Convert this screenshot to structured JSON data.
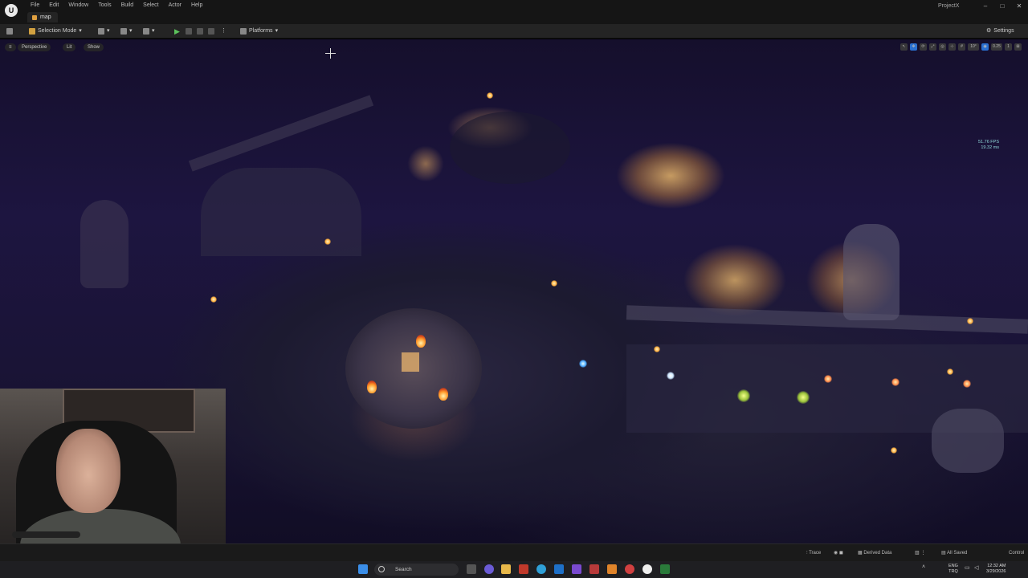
{
  "window": {
    "menu": [
      "File",
      "Edit",
      "Window",
      "Tools",
      "Build",
      "Select",
      "Actor",
      "Help"
    ],
    "tab_label": "map",
    "project_name": "ProjectX",
    "controls": [
      "–",
      "□",
      "✕"
    ]
  },
  "toolbar": {
    "selection_mode": "Selection Mode",
    "platforms": "Platforms",
    "settings": "Settings"
  },
  "viewport": {
    "perspective": "Perspective",
    "lit": "Lit",
    "show": "Show",
    "grid_snap": "10°",
    "camera_speed": "0.25",
    "screen_pct": "1",
    "fps": "51.76 FPS",
    "frame_ms": "19.32 ms"
  },
  "statusbar": {
    "trace": "Trace",
    "derived_data": "Derived Data",
    "all_saved": "All Saved",
    "source_control": "Control"
  },
  "taskbar": {
    "search_placeholder": "Search",
    "lang_primary": "ENG",
    "lang_secondary": "TRQ",
    "time": "12:32 AM",
    "date": "3/29/2026"
  },
  "colors": {
    "accent": "#2a6fd0",
    "play_green": "#5cc35c",
    "fps_text": "#8fd8d8"
  }
}
